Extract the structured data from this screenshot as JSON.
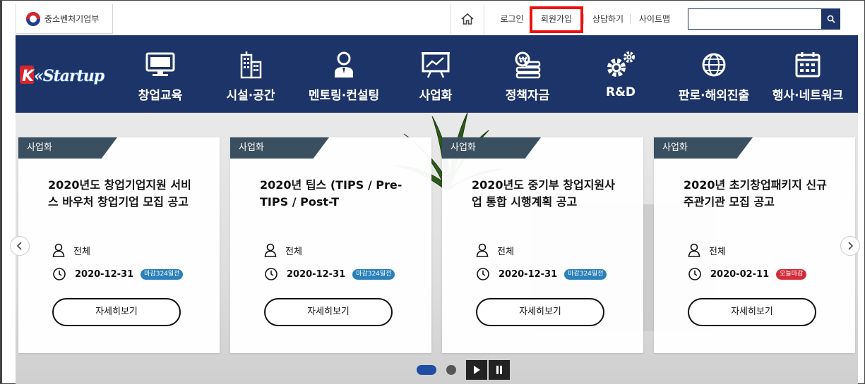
{
  "top": {
    "gov_logo_text": "중소벤처기업부",
    "links": [
      "로그인",
      "회원가입",
      "상담하기",
      "사이트맵"
    ],
    "search": {
      "value": "",
      "placeholder": ""
    }
  },
  "nav": {
    "brand": "K-Startup",
    "items": [
      {
        "label": "창업교육",
        "icon": "monitor-icon"
      },
      {
        "label": "시설·공간",
        "icon": "building-icon"
      },
      {
        "label": "멘토링·컨설팅",
        "icon": "mentor-icon"
      },
      {
        "label": "사업화",
        "icon": "presentation-chart-icon"
      },
      {
        "label": "정책자금",
        "icon": "money-icon"
      },
      {
        "label": "R&D",
        "icon": "gears-icon"
      },
      {
        "label": "판로·해외진출",
        "icon": "globe-icon"
      },
      {
        "label": "행사·네트워크",
        "icon": "calendar-icon"
      }
    ]
  },
  "cards": [
    {
      "tag": "사업화",
      "title": "2020년도 창업기업지원 서비스 바우처 창업기업 모집 공고",
      "target": "전체",
      "date": "2020-12-31",
      "badge": "마감324일전",
      "more": "자세히보기"
    },
    {
      "tag": "사업화",
      "title": "2020년 팁스 (TIPS / Pre-TIPS / Post-T",
      "target": "전체",
      "date": "2020-12-31",
      "badge": "마감324일전",
      "more": "자세히보기"
    },
    {
      "tag": "사업화",
      "title": "2020년도 중기부 창업지원사업 통합 시행계획 공고",
      "target": "전체",
      "date": "2020-12-31",
      "badge": "마감324일전",
      "more": "자세히보기"
    },
    {
      "tag": "사업화",
      "title": "2020년 초기창업패키지 신규 주관기관 모집 공고",
      "target": "전체",
      "date": "2020-02-11",
      "badge": "오늘마감",
      "more": "자세히보기"
    }
  ],
  "colors": {
    "nav_bg": "#1d3468",
    "badge_blue": "#2a80b9",
    "badge_red": "#d32d3c",
    "highlight": "#ee1111"
  }
}
